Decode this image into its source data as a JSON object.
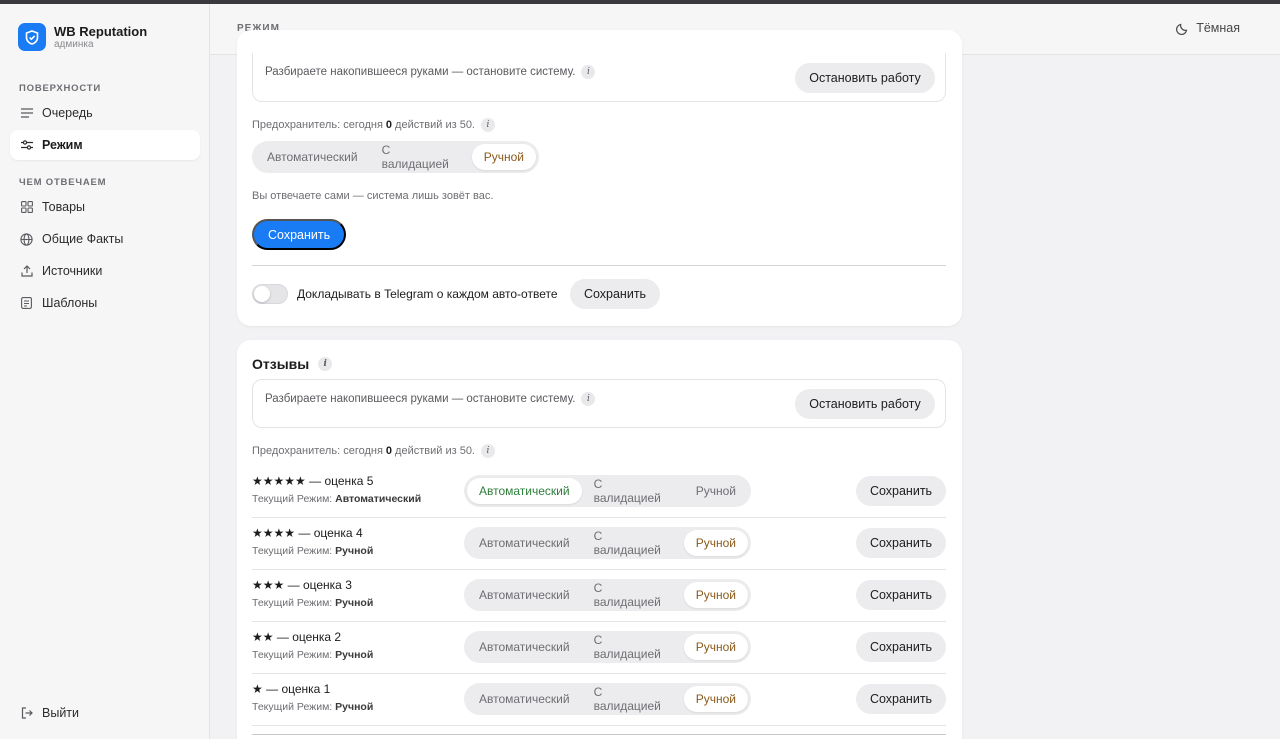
{
  "app": {
    "title": "WB Reputation",
    "subtitle": "админка"
  },
  "sidebar": {
    "section1": "ПОВЕРХНОСТИ",
    "section2": "ЧЕМ ОТВЕЧАЕМ",
    "items": [
      {
        "label": "Очередь",
        "icon": "list-icon"
      },
      {
        "label": "Режим",
        "icon": "sliders-icon",
        "active": true
      },
      {
        "label": "Товары",
        "icon": "grid-icon"
      },
      {
        "label": "Общие Факты",
        "icon": "globe-icon"
      },
      {
        "label": "Источники",
        "icon": "upload-icon"
      },
      {
        "label": "Шаблоны",
        "icon": "document-icon"
      }
    ],
    "logout": "Выйти"
  },
  "header": {
    "title": "РЕЖИМ",
    "theme_label": "Тёмная"
  },
  "card1": {
    "stop_text": "Разбираете накопившееся руками — остановите систему.",
    "stop_button": "Остановить работу",
    "fuse_prefix": "Предохранитель: сегодня",
    "fuse_count": "0",
    "fuse_suffix": "действий из 50.",
    "modes": [
      "Автоматический",
      "С валидацией",
      "Ручной"
    ],
    "selected_mode": "Ручной",
    "description": "Вы отвечаете сами — система лишь зовёт вас.",
    "save_button": "Сохранить",
    "telegram_label": "Докладывать в Telegram о каждом авто-ответе",
    "telegram_enabled": false,
    "telegram_save": "Сохранить"
  },
  "reviews": {
    "title": "Отзывы",
    "stop_text": "Разбираете накопившееся руками — остановите систему.",
    "stop_button": "Остановить работу",
    "fuse_prefix": "Предохранитель: сегодня",
    "fuse_count": "0",
    "fuse_suffix": "действий из 50.",
    "current_label": "Текущий Режим:",
    "modes": [
      "Автоматический",
      "С валидацией",
      "Ручной"
    ],
    "save_button": "Сохранить",
    "rows": [
      {
        "stars": "★★★★★",
        "label": "— оценка 5",
        "current": "Автоматический",
        "selected": "auto"
      },
      {
        "stars": "★★★★",
        "label": "— оценка 4",
        "current": "Ручной",
        "selected": "manual"
      },
      {
        "stars": "★★★",
        "label": "— оценка 3",
        "current": "Ручной",
        "selected": "manual"
      },
      {
        "stars": "★★",
        "label": "— оценка 2",
        "current": "Ручной",
        "selected": "manual"
      },
      {
        "stars": "★",
        "label": "— оценка 1",
        "current": "Ручной",
        "selected": "manual"
      }
    ]
  },
  "colors": {
    "accent": "#1a7cf5",
    "manual_selected_text": "#8a5a1c",
    "auto_selected_text": "#2e7d3a"
  }
}
